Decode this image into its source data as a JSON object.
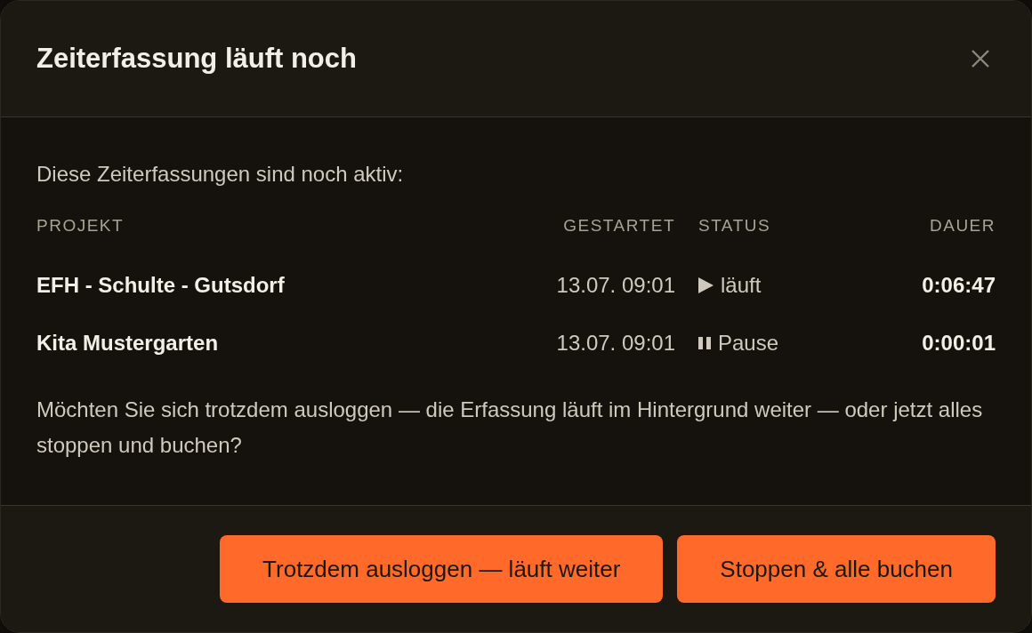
{
  "dialog": {
    "title": "Zeiterfassung läuft noch",
    "intro": "Diese Zeiterfassungen sind noch aktiv:",
    "columns": [
      "PROJEKT",
      "GESTARTET",
      "STATUS",
      "DAUER"
    ],
    "rows": [
      {
        "project": "EFH - Schulte - Gutsdorf",
        "started": "13.07. 09:01",
        "status": {
          "kind": "running",
          "label": "läuft"
        },
        "duration": "0:06:47"
      },
      {
        "project": "Kita Mustergarten",
        "started": "13.07. 09:01",
        "status": {
          "kind": "paused",
          "label": "Pause"
        },
        "duration": "0:00:01"
      }
    ],
    "question": "Möchten Sie sich trotzdem ausloggen — die Erfassung läuft im Hintergrund weiter — oder jetzt alles stoppen und buchen?",
    "buttons": [
      "Trotzdem ausloggen — läuft weiter",
      "Stoppen & alle buchen"
    ]
  }
}
